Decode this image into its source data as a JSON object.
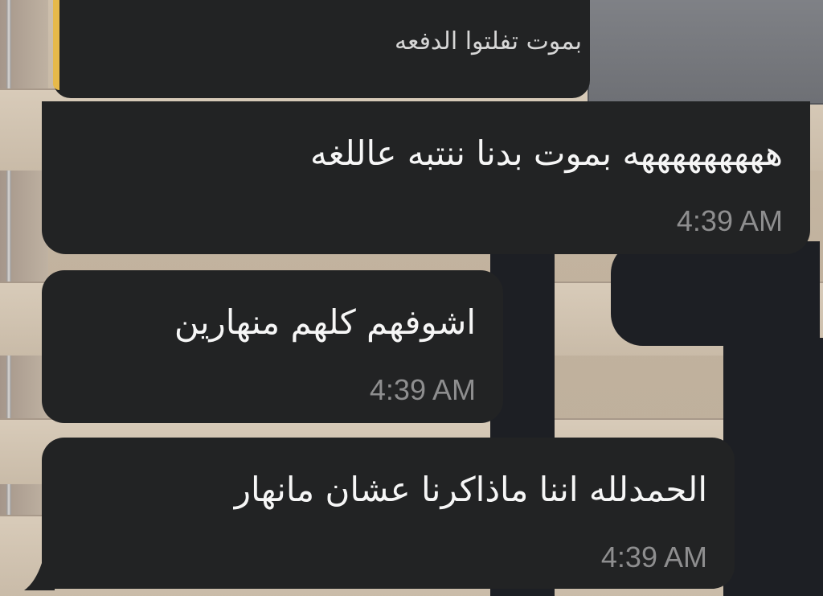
{
  "reply_preview": {
    "text": "بموت تفلتوا الدفعه"
  },
  "messages": [
    {
      "text": "هههههههههه بموت بدنا ننتبه عاللغه",
      "time": "4:39 AM"
    },
    {
      "text": "اشوفهم كلهم منهارين",
      "time": "4:39 AM"
    },
    {
      "text": "الحمدلله اننا ماذاكرنا عشان مانهار",
      "time": "4:39 AM"
    }
  ],
  "colors": {
    "bubble": "#222324",
    "reply_accent": "#e6b94a",
    "timestamp": "#8e8e8f",
    "text": "#f6f6f6"
  }
}
